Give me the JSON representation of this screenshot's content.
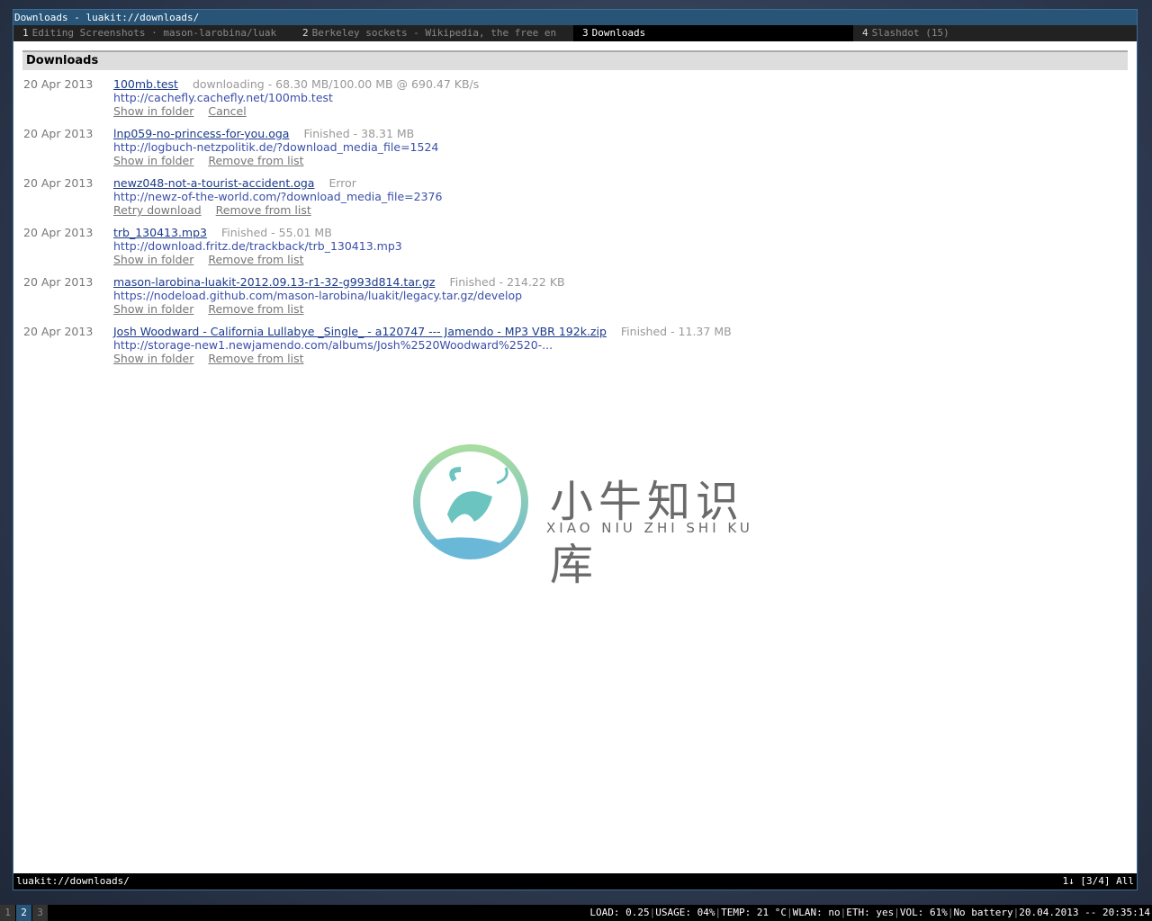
{
  "window": {
    "title": "Downloads - luakit://downloads/"
  },
  "tabs": [
    {
      "num": "1",
      "label": "Editing Screenshots · mason-larobina/luak",
      "active": false
    },
    {
      "num": "2",
      "label": "Berkeley sockets - Wikipedia, the free en",
      "active": false
    },
    {
      "num": "3",
      "label": "Downloads",
      "active": true
    },
    {
      "num": "4",
      "label": "Slashdot (15)",
      "active": false
    }
  ],
  "page": {
    "heading": "Downloads",
    "downloads": [
      {
        "date": "20 Apr 2013",
        "name": "100mb.test",
        "status": "downloading - 68.30 MB/100.00 MB @ 690.47 KB/s",
        "url": "http://cachefly.cachefly.net/100mb.test",
        "actions": [
          "Show in folder",
          "Cancel"
        ]
      },
      {
        "date": "20 Apr 2013",
        "name": "lnp059-no-princess-for-you.oga",
        "status": "Finished - 38.31 MB",
        "url": "http://logbuch-netzpolitik.de/?download_media_file=1524",
        "actions": [
          "Show in folder",
          "Remove from list"
        ]
      },
      {
        "date": "20 Apr 2013",
        "name": "newz048-not-a-tourist-accident.oga",
        "status": "Error",
        "url": "http://newz-of-the-world.com/?download_media_file=2376",
        "actions": [
          "Retry download",
          "Remove from list"
        ]
      },
      {
        "date": "20 Apr 2013",
        "name": "trb_130413.mp3",
        "status": "Finished - 55.01 MB",
        "url": "http://download.fritz.de/trackback/trb_130413.mp3",
        "actions": [
          "Show in folder",
          "Remove from list"
        ]
      },
      {
        "date": "20 Apr 2013",
        "name": "mason-larobina-luakit-2012.09.13-r1-32-g993d814.tar.gz",
        "status": "Finished - 214.22 KB",
        "url": "https://nodeload.github.com/mason-larobina/luakit/legacy.tar.gz/develop",
        "actions": [
          "Show in folder",
          "Remove from list"
        ]
      },
      {
        "date": "20 Apr 2013",
        "name": "Josh Woodward - California Lullabye _Single_ - a120747 --- Jamendo - MP3 VBR 192k.zip",
        "status": "Finished - 11.37 MB",
        "url": "http://storage-new1.newjamendo.com/albums/Josh%2520Woodward%2520-...",
        "actions": [
          "Show in folder",
          "Remove from list"
        ]
      }
    ]
  },
  "watermark": {
    "title": "小牛知识库",
    "subtitle": "XIAO NIU ZHI SHI KU"
  },
  "statusbar": {
    "url": "luakit://downloads/",
    "right": "1↓ [3/4] All"
  },
  "taskbar": {
    "tags": [
      {
        "label": "1",
        "active": false
      },
      {
        "label": "2",
        "active": true
      },
      {
        "label": "3",
        "active": false
      }
    ],
    "sysinfo": [
      "LOAD: 0.25",
      "USAGE: 04%",
      "TEMP: 21 °C",
      "WLAN: no",
      "ETH: yes",
      "VOL: 61%",
      "No battery",
      "20.04.2013 -- 20:35:14"
    ]
  },
  "colors": {
    "accent": "#285577",
    "link": "#1a3a8c",
    "url": "#3a4faa",
    "muted": "#777777"
  }
}
